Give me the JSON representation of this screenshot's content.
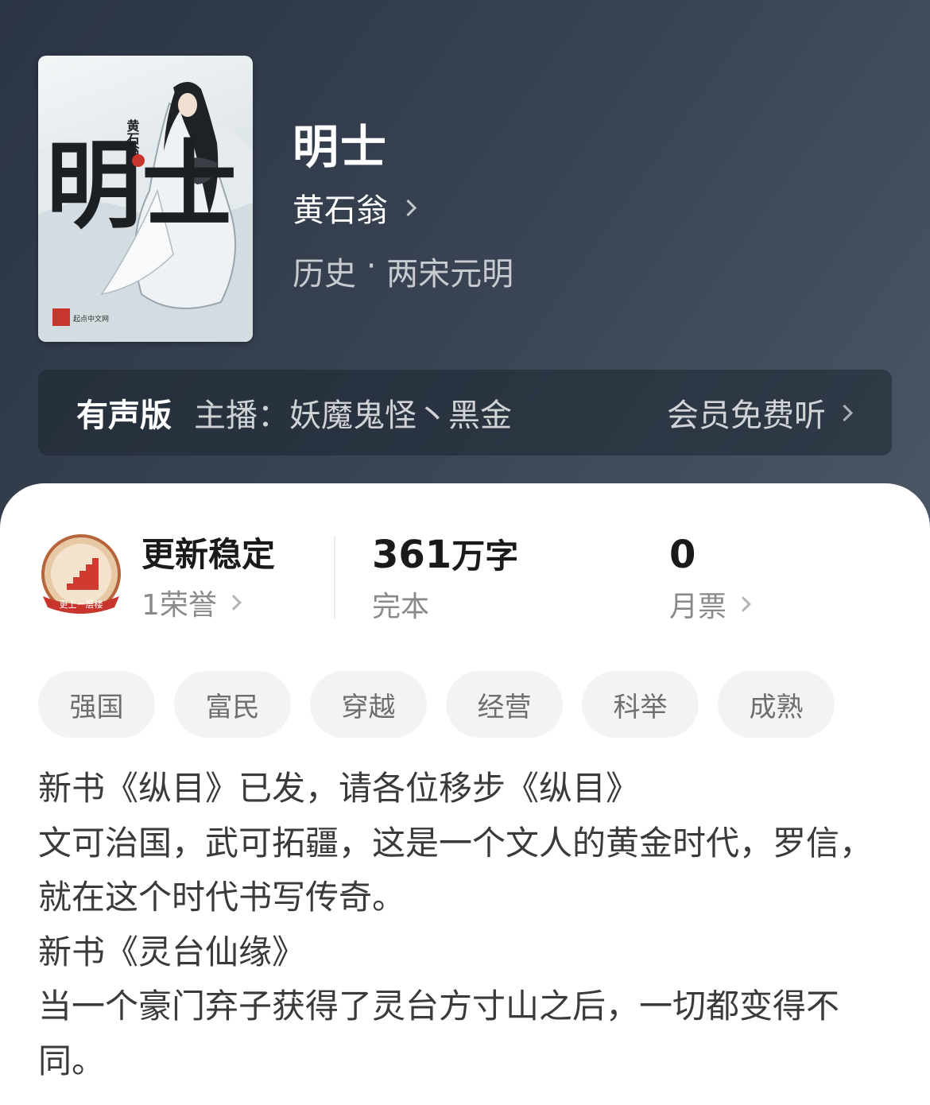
{
  "colors": {
    "header_bg": "#3a4454",
    "panel_bg": "#ffffff",
    "tag_bg": "#f3f3f3",
    "badge_red": "#c8352c"
  },
  "cover": {
    "title_calligraphy": "明士",
    "author_vertical": "黄石翁",
    "author_seal": "著",
    "publisher": "起点中文网"
  },
  "book": {
    "title": "明士",
    "author": "黄石翁",
    "category": "历史",
    "separator": " · ",
    "subcategory": "两宋元明"
  },
  "audio": {
    "label": "有声版",
    "narrator_prefix": "主播：",
    "narrators": "妖魔鬼怪丶黑金",
    "cta": "会员免费听"
  },
  "stats": {
    "honor": {
      "badge_text": "更上一层楼",
      "title": "更新稳定",
      "sub": "1荣誉"
    },
    "words": {
      "number": "361",
      "unit": "万字",
      "sub": "完本"
    },
    "tickets": {
      "number": "0",
      "sub": "月票"
    }
  },
  "tags": [
    "强国",
    "富民",
    "穿越",
    "经营",
    "科举",
    "成熟"
  ],
  "description": [
    "新书《纵目》已发，请各位移步《纵目》",
    "文可治国，武可拓疆，这是一个文人的黄金时代，罗信，就在这个时代书写传奇。",
    "新书《灵台仙缘》",
    "当一个豪门弃子获得了灵台方寸山之后，一切都变得不同。"
  ]
}
